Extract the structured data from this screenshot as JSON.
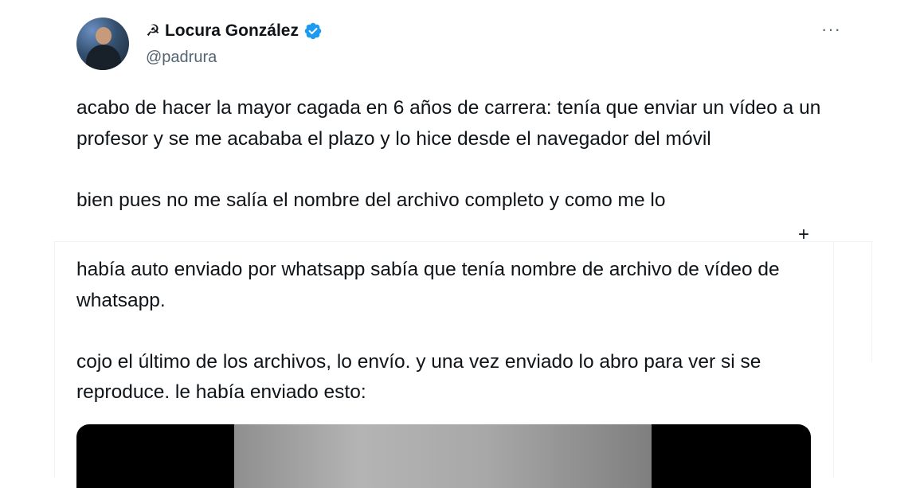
{
  "author": {
    "name_prefix": "☭",
    "display_name": "Locura González",
    "handle": "@padrura",
    "verified": true,
    "avatar_icon": "user-avatar-photo"
  },
  "tweet": {
    "text": "acabo de hacer la mayor cagada en 6 años de carrera: tenía que enviar un vídeo a un profesor y se me acababa el plazo y lo hice desde el navegador del móvil\n\nbien pues no me salía el nombre del archivo completo y como me lo"
  },
  "expand": {
    "label": "+"
  },
  "quoted_text": "había auto enviado por whatsapp sabía que tenía nombre de archivo de vídeo de whatsapp.\n\ncojo el último de los archivos, lo envío. y una vez enviado lo abro para ver si se reproduce. le había enviado esto:",
  "more_menu": {
    "icon": "more-horizontal-icon",
    "label": "···"
  },
  "colors": {
    "text": "#0f1419",
    "secondary": "#536471",
    "verified": "#1d9bf0",
    "border": "#eff3f4"
  }
}
